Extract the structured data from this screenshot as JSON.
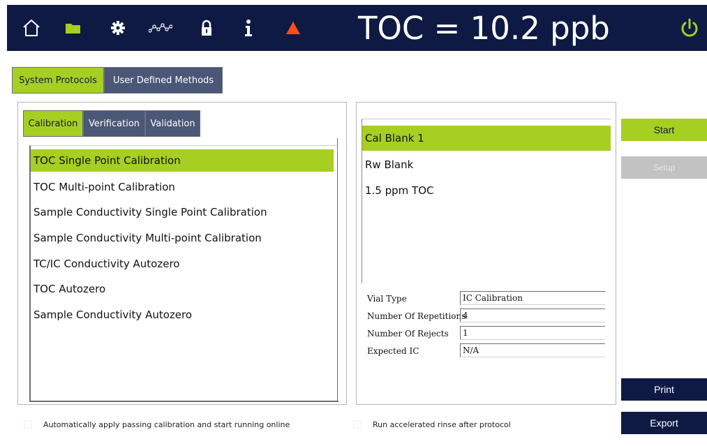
{
  "header": {
    "readout": "TOC = 10.2 ppb",
    "icons": [
      "home-icon",
      "folder-icon",
      "gear-icon",
      "data-trend-icon",
      "lock-icon",
      "info-icon",
      "warning-icon",
      "power-icon"
    ],
    "colors": {
      "bar": "#0e1a44",
      "accent": "#a6cf22",
      "warning": "#ff4a1c",
      "power": "#a6cf22"
    }
  },
  "top_tabs": [
    {
      "label": "System Protocols",
      "active": true
    },
    {
      "label": "User Defined Methods",
      "active": false
    }
  ],
  "sub_tabs": [
    {
      "label": "Calibration",
      "active": true
    },
    {
      "label": "Verification",
      "active": false
    },
    {
      "label": "Validation",
      "active": false
    }
  ],
  "methods": [
    {
      "label": "TOC Single Point Calibration",
      "selected": true
    },
    {
      "label": "TOC Multi-point Calibration",
      "selected": false
    },
    {
      "label": "Sample Conductivity Single Point Calibration",
      "selected": false
    },
    {
      "label": "Sample Conductivity Multi-point Calibration",
      "selected": false
    },
    {
      "label": "TC/IC Conductivity Autozero",
      "selected": false
    },
    {
      "label": "TOC Autozero",
      "selected": false
    },
    {
      "label": "Sample Conductivity Autozero",
      "selected": false
    }
  ],
  "samples": [
    {
      "label": "Cal Blank 1",
      "selected": true
    },
    {
      "label": "Rw Blank",
      "selected": false
    },
    {
      "label": "1.5 ppm TOC",
      "selected": false
    }
  ],
  "params": [
    {
      "label": "Vial Type",
      "value": "IC Calibration"
    },
    {
      "label": "Number Of Repetitions",
      "value": "4"
    },
    {
      "label": "Number Of Rejects",
      "value": "1"
    },
    {
      "label": "Expected IC",
      "value": "N/A"
    }
  ],
  "buttons": {
    "start": "Start",
    "setup": "Setup",
    "print": "Print",
    "export": "Export"
  },
  "options": {
    "auto_apply": "Automatically apply passing calibration and start running online",
    "accelerated_rinse": "Run accelerated rinse after protocol"
  }
}
